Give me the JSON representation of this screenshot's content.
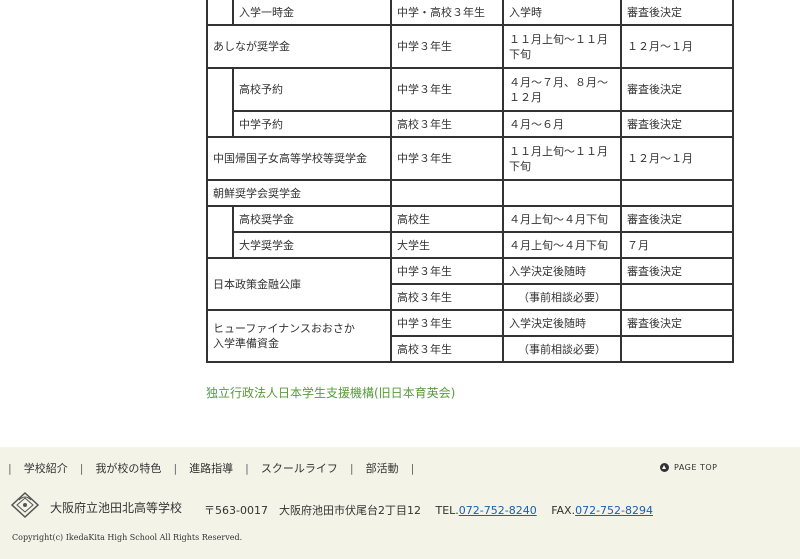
{
  "table": {
    "rows": [
      {
        "name": "入学一時金",
        "grade": "中学・高校３年生",
        "period": "入学時",
        "result": "審査後決定"
      },
      {
        "name": "あしなが奨学金",
        "grade": "中学３年生",
        "period": "１１月上旬～１１月下旬",
        "result": "１２月～１月"
      },
      {
        "name": "高校予約",
        "grade": "中学３年生",
        "period": "４月～７月、８月～１２月",
        "result": "審査後決定"
      },
      {
        "name": "中学予約",
        "grade": "高校３年生",
        "period": "４月～６月",
        "result": "審査後決定"
      },
      {
        "name": "中国帰国子女高等学校等奨学金",
        "grade": "中学３年生",
        "period": "１１月上旬～１１月下旬",
        "result": "１２月～１月"
      },
      {
        "name": "朝鮮奨学会奨学金",
        "grade": "",
        "period": "",
        "result": ""
      },
      {
        "name": "高校奨学金",
        "grade": "高校生",
        "period": "４月上旬～４月下旬",
        "result": "審査後決定"
      },
      {
        "name": "大学奨学金",
        "grade": "大学生",
        "period": "４月上旬～４月下旬",
        "result": "７月"
      },
      {
        "name": "日本政策金融公庫",
        "grade": "中学３年生",
        "period": "入学決定後随時",
        "result": "審査後決定"
      },
      {
        "name": "",
        "grade": "高校３年生",
        "period": "（事前相談必要）",
        "result": ""
      },
      {
        "name": "ヒューファイナンスおおさか\n入学準備資金",
        "grade": "中学３年生",
        "period": "入学決定後随時",
        "result": "審査後決定"
      },
      {
        "name": "",
        "grade": "高校３年生",
        "period": "（事前相談必要）",
        "result": ""
      }
    ]
  },
  "jasso_link": "独立行政法人日本学生支援機構(旧日本育英会)",
  "footer": {
    "nav": [
      "学校紹介",
      "我が校の特色",
      "進路指導",
      "スクールライフ",
      "部活動"
    ],
    "separator": "|",
    "page_top": "PAGE TOP",
    "school_name": "大阪府立池田北高等学校",
    "address": "〒563-0017　大阪府池田市伏尾台2丁目12",
    "tel_label": "TEL.",
    "tel": "072-752-8240",
    "fax_label": "FAX.",
    "fax": "072-752-8294",
    "copyright": "Copyright(c) IkedaKita High School All Rights Reserved."
  },
  "colors": {
    "link_green": "#5a9a3c",
    "footer_bg": "#f3f3e8",
    "phone_link": "#1a5fb4"
  }
}
